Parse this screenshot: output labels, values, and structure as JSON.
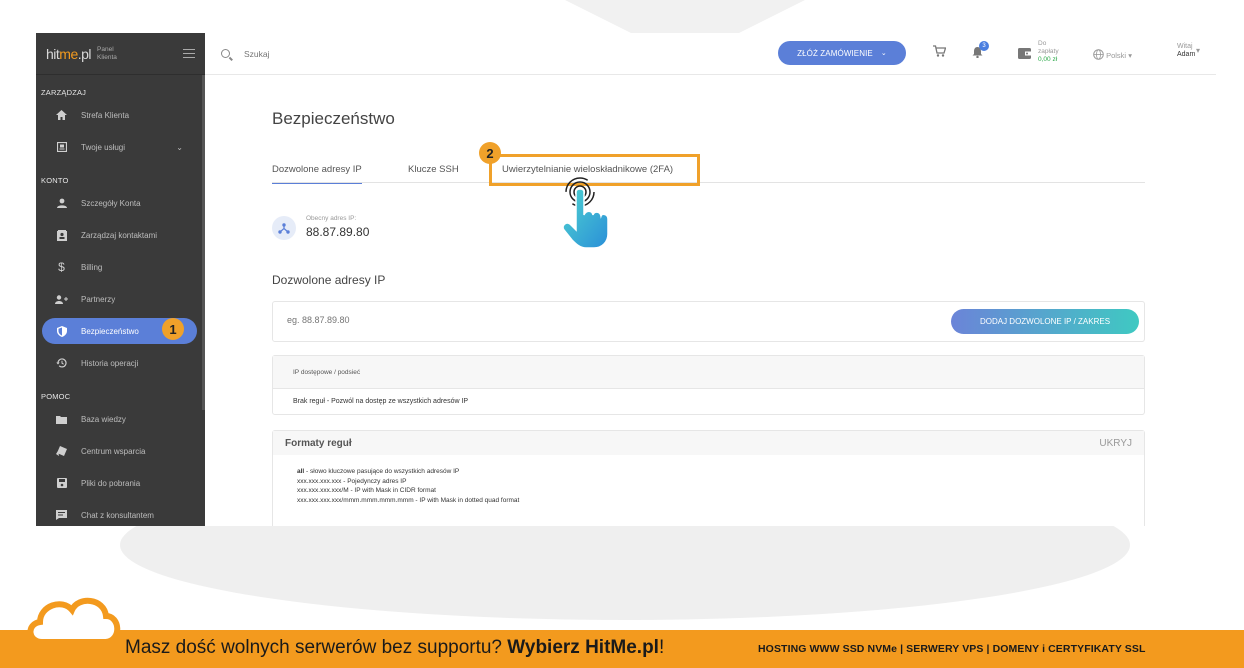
{
  "sidebar": {
    "logo": "hitme.pl",
    "logo_sub_1": "Panel",
    "logo_sub_2": "Klienta",
    "sections": {
      "manage": "ZARZĄDZAJ",
      "account": "KONTO",
      "help": "POMOC"
    },
    "items": [
      {
        "label": "Strefa Klienta",
        "icon": "home-icon"
      },
      {
        "label": "Twoje usługi",
        "icon": "services-icon"
      },
      {
        "label": "Szczegóły Konta",
        "icon": "user-icon"
      },
      {
        "label": "Zarządzaj kontaktami",
        "icon": "contacts-icon"
      },
      {
        "label": "Billing",
        "icon": "dollar-icon"
      },
      {
        "label": "Partnerzy",
        "icon": "partners-icon"
      },
      {
        "label": "Bezpieczeństwo",
        "icon": "shield-icon"
      },
      {
        "label": "Historia operacji",
        "icon": "history-icon"
      },
      {
        "label": "Baza wiedzy",
        "icon": "folder-icon"
      },
      {
        "label": "Centrum wsparcia",
        "icon": "support-icon"
      },
      {
        "label": "Pliki do pobrania",
        "icon": "save-icon"
      },
      {
        "label": "Chat z konsultantem",
        "icon": "chat-icon"
      }
    ]
  },
  "topbar": {
    "search_placeholder": "Szukaj",
    "order_label": "ZŁÓŻ ZAMÓWIENIE",
    "notif_count": "3",
    "pay_line1": "Do",
    "pay_line2": "zapłaty",
    "pay_amount": "0,00 zł",
    "language": "Polski",
    "greeting": "Witaj",
    "user_name": "Adam"
  },
  "main": {
    "title": "Bezpieczeństwo",
    "tabs": [
      {
        "label": "Dozwolone adresy IP"
      },
      {
        "label": "Klucze SSH"
      },
      {
        "label": "Uwierzytelnianie wieloskładnikowe (2FA)"
      }
    ],
    "current_ip_label": "Obecny adres IP:",
    "current_ip": "88.87.89.80",
    "allowed_title": "Dozwolone adresy IP",
    "ip_placeholder": "eg. 88.87.89.80",
    "add_button": "DODAJ DOZWOLONE IP / ZAKRES",
    "table_header": "IP dostępowe / podsieć",
    "table_row": "Brak reguł - Pozwól na dostęp ze wszystkich adresów IP",
    "rules_title": "Formaty reguł",
    "rules_hide": "UKRYJ",
    "rules": [
      {
        "key": "all",
        "text": " - słowo kluczowe pasujące do wszystkich adresów IP"
      },
      {
        "key": "",
        "text": "xxx.xxx.xxx.xxx - Pojedynczy adres IP"
      },
      {
        "key": "",
        "text": "xxx.xxx.xxx.xxx/M - IP with Mask in CIDR format"
      },
      {
        "key": "",
        "text": "xxx.xxx.xxx.xxx/mmm.mmm.mmm.mmm - IP with Mask in dotted quad format"
      }
    ]
  },
  "annotations": {
    "step1": "1",
    "step2": "2"
  },
  "footer": {
    "promo_text": "Masz dość wolnych serwerów bez supportu? ",
    "promo_bold": "Wybierz HitMe.pl",
    "promo_end": "!",
    "services": "HOSTING WWW SSD NVMe | SERWERY VPS | DOMENY i CERTYFIKATY SSL"
  },
  "colors": {
    "accent": "#5b7fd8",
    "highlight": "#f0a12a",
    "footer": "#f39a1e",
    "sidebar": "#3a3a3a"
  }
}
